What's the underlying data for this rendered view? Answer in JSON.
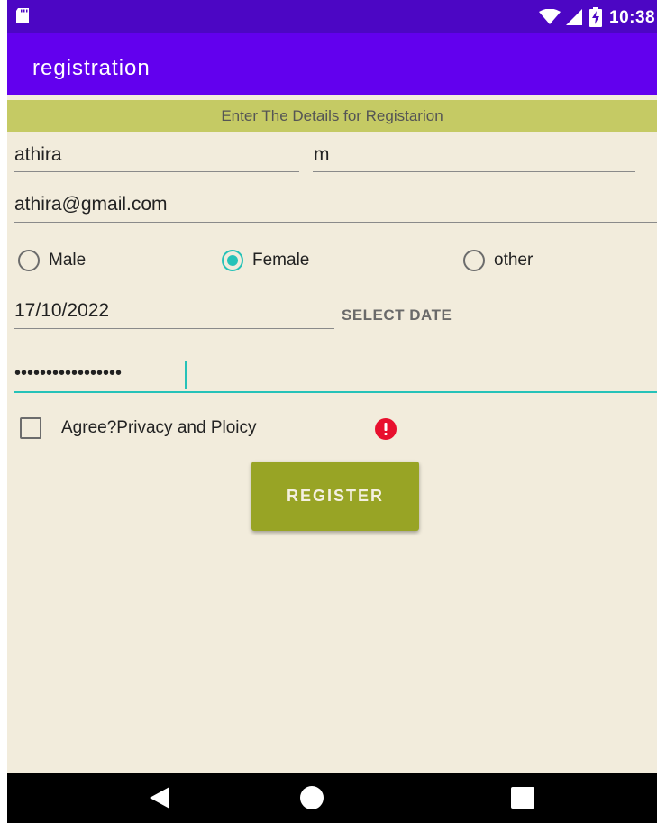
{
  "status_bar": {
    "time": "10:38",
    "icons": [
      "sd-card-icon",
      "wifi-icon",
      "signal-icon",
      "battery-charging-icon"
    ],
    "background_color": "#4c06c4"
  },
  "app_bar": {
    "title": "registration",
    "background_color": "#6200ee"
  },
  "banner": {
    "text": "Enter The Details for Registarion",
    "background_color": "#c5ca64"
  },
  "form": {
    "first_name": "athira",
    "last_name": "m",
    "email": "athira@gmail.com",
    "gender": {
      "options": [
        "Male",
        "Female",
        "other"
      ],
      "selected": "Female"
    },
    "date": "17/10/2022",
    "select_date_label": "SELECT DATE",
    "password_masked": "•••••••••••••••••",
    "agree_label": "Agree?Privacy and Ploicy",
    "agree_checked": false,
    "agree_error": true,
    "register_label": "REGISTER",
    "accent_color": "#26c2b8",
    "button_color": "#98a425"
  },
  "nav_bar": {
    "buttons": [
      "back-icon",
      "home-icon",
      "recents-icon"
    ]
  }
}
